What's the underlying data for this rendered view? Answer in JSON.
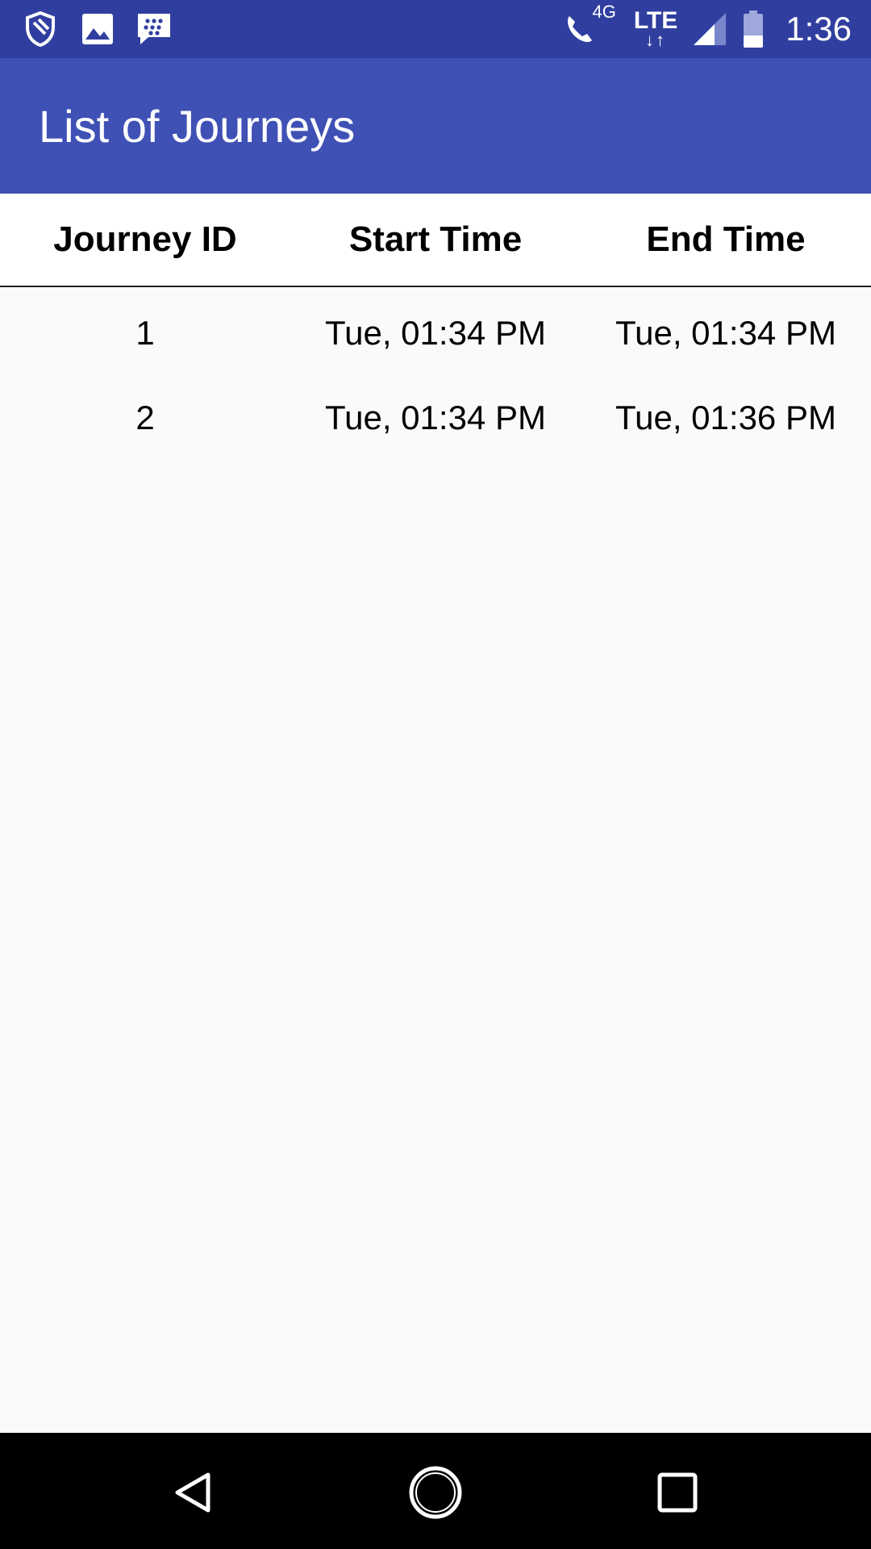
{
  "status_bar": {
    "time": "1:36",
    "network_label": "LTE",
    "network_arrows": "↓↑",
    "call_label": "4G",
    "left_icons": [
      "security-shield-icon",
      "image-icon",
      "bbm-chat-icon"
    ],
    "right_icons": [
      "wifi-call-icon",
      "lte-icon",
      "signal-icon",
      "battery-icon"
    ]
  },
  "app_bar": {
    "title": "List of Journeys"
  },
  "table": {
    "headers": [
      "Journey ID",
      "Start Time",
      "End Time"
    ],
    "rows": [
      [
        "1",
        "Tue, 01:34 PM",
        "Tue, 01:34 PM"
      ],
      [
        "2",
        "Tue, 01:34 PM",
        "Tue, 01:36 PM"
      ]
    ]
  },
  "nav_bar": {
    "icons": [
      "back-icon",
      "home-icon",
      "recents-icon"
    ]
  },
  "colors": {
    "status_bar": "#303f9f",
    "app_bar": "#3f51b5",
    "background": "#fafafa",
    "nav_bar": "#000000"
  }
}
